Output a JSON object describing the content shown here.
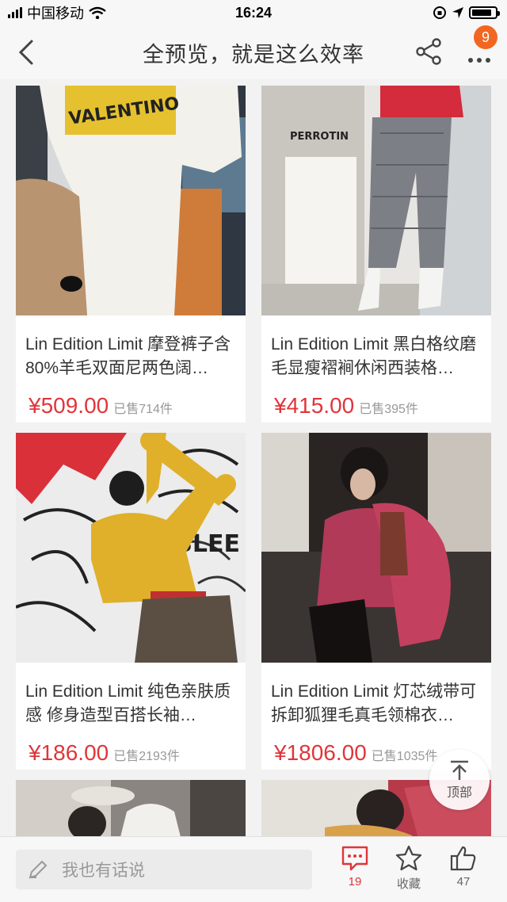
{
  "status_bar": {
    "carrier": "中国移动",
    "time": "16:24"
  },
  "nav": {
    "title": "全预览，就是这么效率",
    "badge_count": "9"
  },
  "products": [
    {
      "title": "Lin Edition Limit 摩登裤子含80%羊毛双面尼两色阔…",
      "price": "¥509.00",
      "sold": "已售714件"
    },
    {
      "title": "Lin Edition Limit 黑白格纹磨毛显瘦褶裥休闲西装格…",
      "price": "¥415.00",
      "sold": "已售395件"
    },
    {
      "title": "Lin Edition Limit 纯色亲肤质感 修身造型百搭长袖…",
      "price": "¥186.00",
      "sold": "已售2193件"
    },
    {
      "title": "Lin Edition Limit 灯芯绒带可拆卸狐狸毛真毛领棉衣…",
      "price": "¥1806.00",
      "sold": "已售1035件"
    }
  ],
  "image_text": {
    "valentino": "VALENTINO",
    "perrotin": "PERROTIN",
    "bleek": "BLEE"
  },
  "to_top": {
    "label": "顶部"
  },
  "bottom_bar": {
    "comment_placeholder": "我也有话说",
    "comment_count": "19",
    "favorite_label": "收藏",
    "like_count": "47"
  },
  "colors": {
    "price": "#e0353b",
    "badge": "#f26622",
    "background": "#f2f2f2"
  }
}
